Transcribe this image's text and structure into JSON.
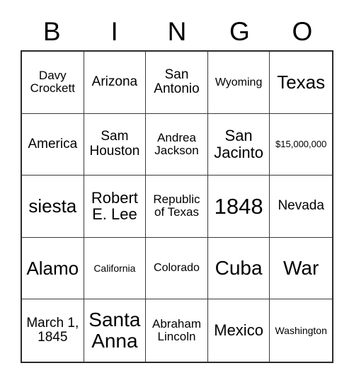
{
  "card": {
    "title": "BINGO",
    "columns": [
      "B",
      "I",
      "N",
      "G",
      "O"
    ],
    "border_color": "#2a2a2a",
    "grid_line_color": "#3a3a3a",
    "background_color": "#ffffff",
    "text_color": "#000000"
  },
  "cells": [
    {
      "text": "Davy Crockett",
      "size": "md"
    },
    {
      "text": "Arizona",
      "size": "lg"
    },
    {
      "text": "San Antonio",
      "size": "lg"
    },
    {
      "text": "Wyoming",
      "size": "smd"
    },
    {
      "text": "Texas",
      "size": "2xl"
    },
    {
      "text": "America",
      "size": "lg"
    },
    {
      "text": "Sam Houston",
      "size": "lg"
    },
    {
      "text": "Andrea Jackson",
      "size": "md"
    },
    {
      "text": "San Jacinto",
      "size": "xl"
    },
    {
      "text": "$15,000,000",
      "size": "xs"
    },
    {
      "text": "siesta",
      "size": "2xl"
    },
    {
      "text": "Robert E. Lee",
      "size": "xl"
    },
    {
      "text": "Republic of Texas",
      "size": "md"
    },
    {
      "text": "1848",
      "size": "4xl"
    },
    {
      "text": "Nevada",
      "size": "lg"
    },
    {
      "text": "Alamo",
      "size": "2xl"
    },
    {
      "text": "California",
      "size": "sm"
    },
    {
      "text": "Colorado",
      "size": "smd"
    },
    {
      "text": "Cuba",
      "size": "3xl"
    },
    {
      "text": "War",
      "size": "3xl"
    },
    {
      "text": "March 1, 1845",
      "size": "lg"
    },
    {
      "text": "Santa Anna",
      "size": "3xl"
    },
    {
      "text": "Abraham Lincoln",
      "size": "md"
    },
    {
      "text": "Mexico",
      "size": "xl"
    },
    {
      "text": "Washington",
      "size": "sm"
    }
  ]
}
